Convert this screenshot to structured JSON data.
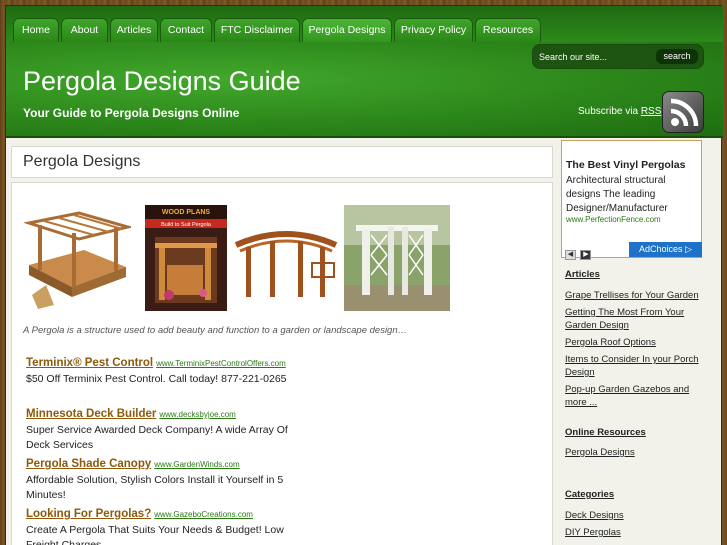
{
  "nav": {
    "items": [
      {
        "label": "Home"
      },
      {
        "label": "About"
      },
      {
        "label": "Articles"
      },
      {
        "label": "Contact"
      },
      {
        "label": "FTC Disclaimer"
      },
      {
        "label": "Pergola Designs"
      },
      {
        "label": "Privacy Policy"
      },
      {
        "label": "Resources"
      }
    ]
  },
  "header": {
    "title": "Pergola Designs Guide",
    "tagline": "Your Guide to Pergola Designs Online",
    "search_placeholder": "Search our site...",
    "search_button": "search",
    "subscribe_prefix": "Subscribe via",
    "subscribe_link": "RSS"
  },
  "main": {
    "page_title": "Pergola Designs",
    "caption": "A Pergola is a structure used to add beauty and function to a garden or landscape design…",
    "ads": [
      {
        "title": "Terminix® Pest Control",
        "url": "www.TerminixPestControlOffers.com",
        "text": "$50 Off Terminix Pest Control. Call today! 877-221-0265"
      },
      {
        "title": "Minnesota Deck Builder",
        "url": "www.decksbyjoe.com",
        "text": "Super Service Awarded Deck Company! A wide Array Of Deck Services"
      },
      {
        "title": "Pergola Shade Canopy",
        "url": "www.GardenWinds.com",
        "text": "Affordable Solution, Stylish Colors Install it Yourself in 5 Minutes!"
      },
      {
        "title": "Looking For Pergolas?",
        "url": "www.GazeboCreations.com",
        "text": "Create A Pergola That Suits Your Needs & Budget! Low Freight Charges"
      }
    ],
    "book_cover_text": "WOOD PLANS",
    "book_subtitle": "Build to Suit Pergola"
  },
  "sidebar": {
    "ad": {
      "title": "The Best Vinyl Pergolas",
      "text": "Architectural structural designs The leading Designer/Manufacturer",
      "url": "www.PerfectionFence.com",
      "adchoices": "AdChoices ▷"
    },
    "articles_heading": "Articles",
    "articles": [
      "Grape Trellises for Your Garden",
      "Getting The Most From Your Garden Design",
      "Pergola Roof Options",
      "Items to Consider In your Porch Design",
      "Pop-up Garden Gazebos and more ..."
    ],
    "resources_heading": "Online Resources",
    "resources": [
      "Pergola Designs"
    ],
    "categories_heading": "Categories",
    "categories": [
      "Deck Designs",
      "DIY Pergolas"
    ]
  },
  "colors": {
    "nav_green": "#2b8718",
    "header_green": "#2e8a1c",
    "ad_title_brown": "#8c5a0a",
    "ad_url_green": "#2a7a14",
    "adchoices_blue": "#1e72c8"
  }
}
